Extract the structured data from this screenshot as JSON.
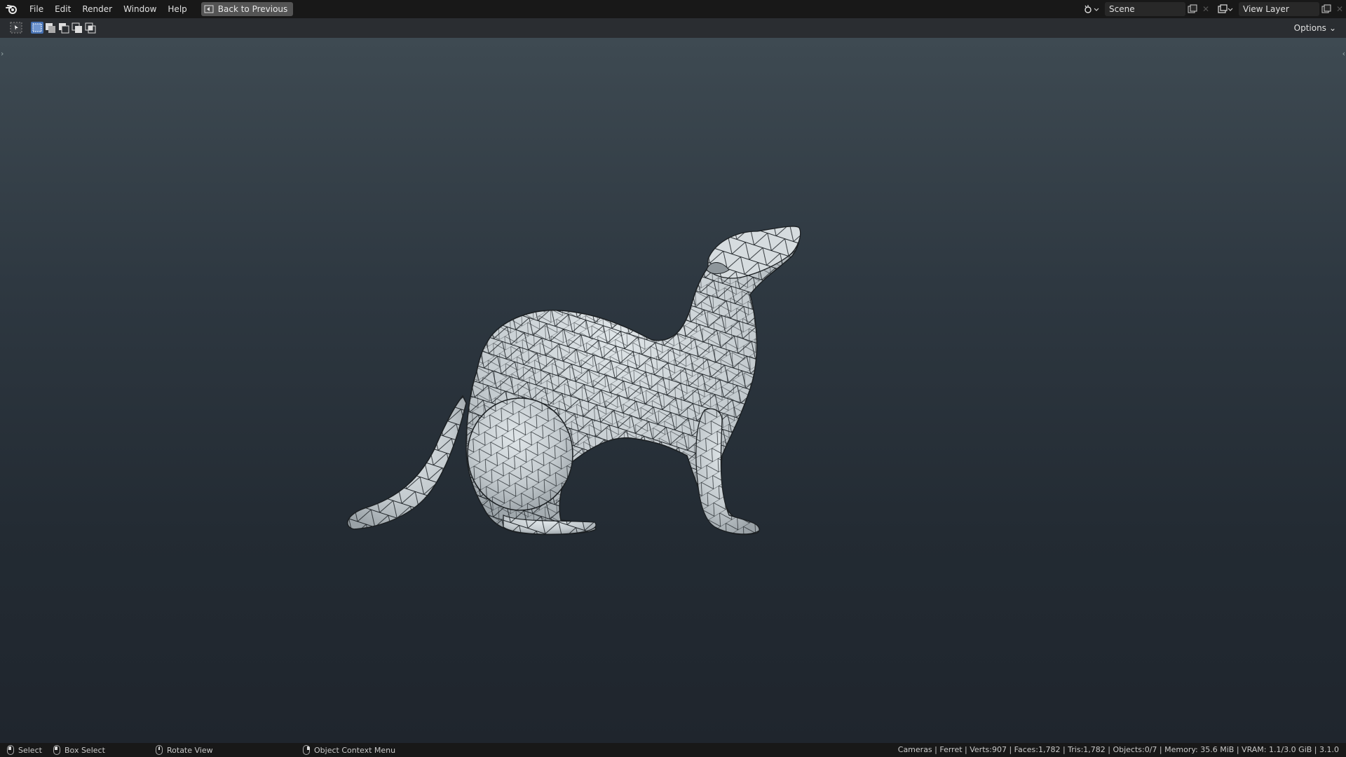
{
  "menubar": {
    "items": [
      "File",
      "Edit",
      "Render",
      "Window",
      "Help"
    ],
    "back_button": "Back to Previous"
  },
  "scene": {
    "name": "Scene"
  },
  "view_layer": {
    "name": "View Layer"
  },
  "tool_header": {
    "options_label": "Options"
  },
  "statusbar": {
    "select": "Select",
    "box_select": "Box Select",
    "rotate_view": "Rotate View",
    "context_menu": "Object Context Menu",
    "stats": "Cameras | Ferret | Verts:907 | Faces:1,782 | Tris:1,782 | Objects:0/7 | Memory: 35.6 MiB | VRAM: 1.1/3.0 GiB | 3.1.0"
  },
  "colors": {
    "accent": "#4772b3",
    "mesh_fill": "#c9d0d4",
    "wire": "#1f2428"
  },
  "icons": [
    "blender-logo-icon",
    "back-icon",
    "scene-icon",
    "view-layer-icon",
    "new-icon",
    "close-icon",
    "select-tool-icon",
    "select-mode-icons",
    "mouse-icon"
  ]
}
